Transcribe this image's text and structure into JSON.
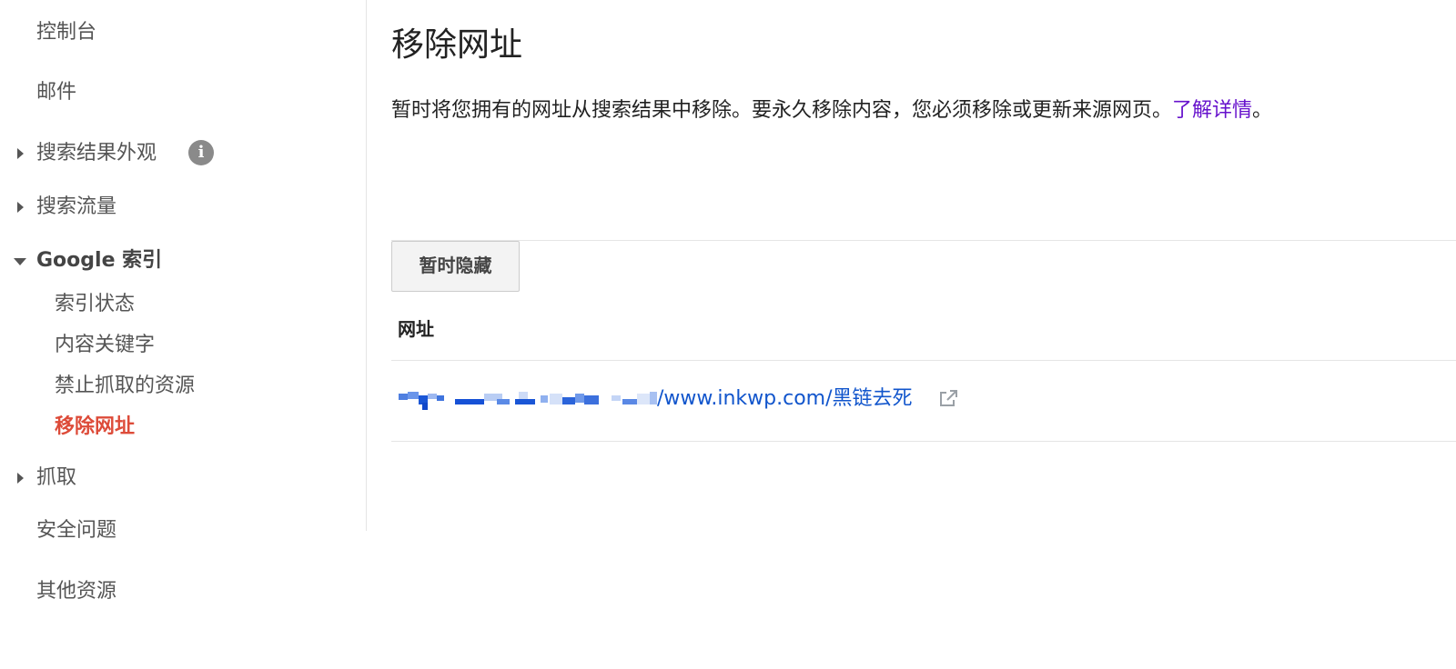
{
  "sidebar": {
    "items": [
      {
        "label": "控制台"
      },
      {
        "label": "邮件"
      },
      {
        "label": "搜索结果外观"
      },
      {
        "label": "搜索流量"
      },
      {
        "label": "Google 索引"
      },
      {
        "label": "抓取"
      },
      {
        "label": "安全问题"
      },
      {
        "label": "其他资源"
      }
    ],
    "info_icon_glyph": "i",
    "google_index_subitems": [
      {
        "label": "索引状态"
      },
      {
        "label": "内容关键字"
      },
      {
        "label": "禁止抓取的资源"
      },
      {
        "label": "移除网址"
      }
    ],
    "active_color": "#dd4b39"
  },
  "main": {
    "title": "移除网址",
    "description": "暂时将您拥有的网址从搜索结果中移除。要永久移除内容，您必须移除或更新来源网页。",
    "learn_more": "了解详情",
    "description_end": "。",
    "hide_button_label": "暂时隐藏",
    "table": {
      "column_header": "网址",
      "rows": [
        {
          "url_visible": "/www.inkwp.com/黑链去死"
        }
      ]
    },
    "link_color": "#1155cc",
    "learn_more_color": "#6611cc"
  }
}
